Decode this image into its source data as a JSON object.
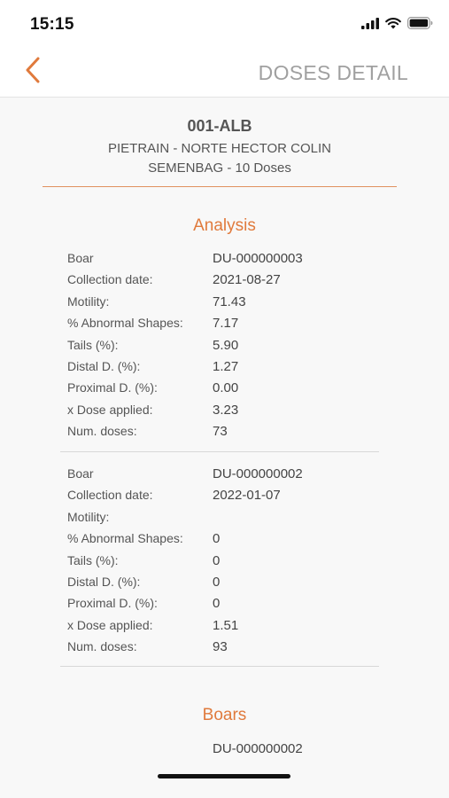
{
  "status_bar": {
    "time": "15:15"
  },
  "nav": {
    "title": "DOSES DETAIL"
  },
  "header": {
    "code": "001-ALB",
    "line1": "PIETRAIN - NORTE HECTOR COLIN",
    "line2": "SEMENBAG - 10 Doses"
  },
  "analysis": {
    "title": "Analysis",
    "records": [
      {
        "rows": [
          {
            "label": "Boar",
            "value": "DU-000000003"
          },
          {
            "label": "Collection date:",
            "value": "2021-08-27"
          },
          {
            "label": "Motility:",
            "value": "71.43"
          },
          {
            "label": "% Abnormal Shapes:",
            "value": "7.17"
          },
          {
            "label": "Tails (%):",
            "value": "5.90"
          },
          {
            "label": "Distal D. (%):",
            "value": "1.27"
          },
          {
            "label": "Proximal D. (%):",
            "value": "0.00"
          },
          {
            "label": "x Dose applied:",
            "value": "3.23"
          },
          {
            "label": "Num. doses:",
            "value": "73"
          }
        ]
      },
      {
        "rows": [
          {
            "label": "Boar",
            "value": "DU-000000002"
          },
          {
            "label": "Collection date:",
            "value": "2022-01-07"
          },
          {
            "label": "Motility:",
            "value": ""
          },
          {
            "label": "% Abnormal Shapes:",
            "value": "0"
          },
          {
            "label": "Tails (%):",
            "value": "0"
          },
          {
            "label": "Distal D. (%):",
            "value": "0"
          },
          {
            "label": "Proximal D. (%):",
            "value": "0"
          },
          {
            "label": "x Dose applied:",
            "value": "1.51"
          },
          {
            "label": "Num. doses:",
            "value": "93"
          }
        ]
      }
    ]
  },
  "boars": {
    "title": "Boars",
    "items": [
      "DU-000000002"
    ]
  },
  "colors": {
    "accent": "#e07a3c",
    "divider": "#e0915f"
  },
  "icons": [
    "signal-icon",
    "wifi-icon",
    "battery-icon",
    "back-chevron-icon"
  ]
}
